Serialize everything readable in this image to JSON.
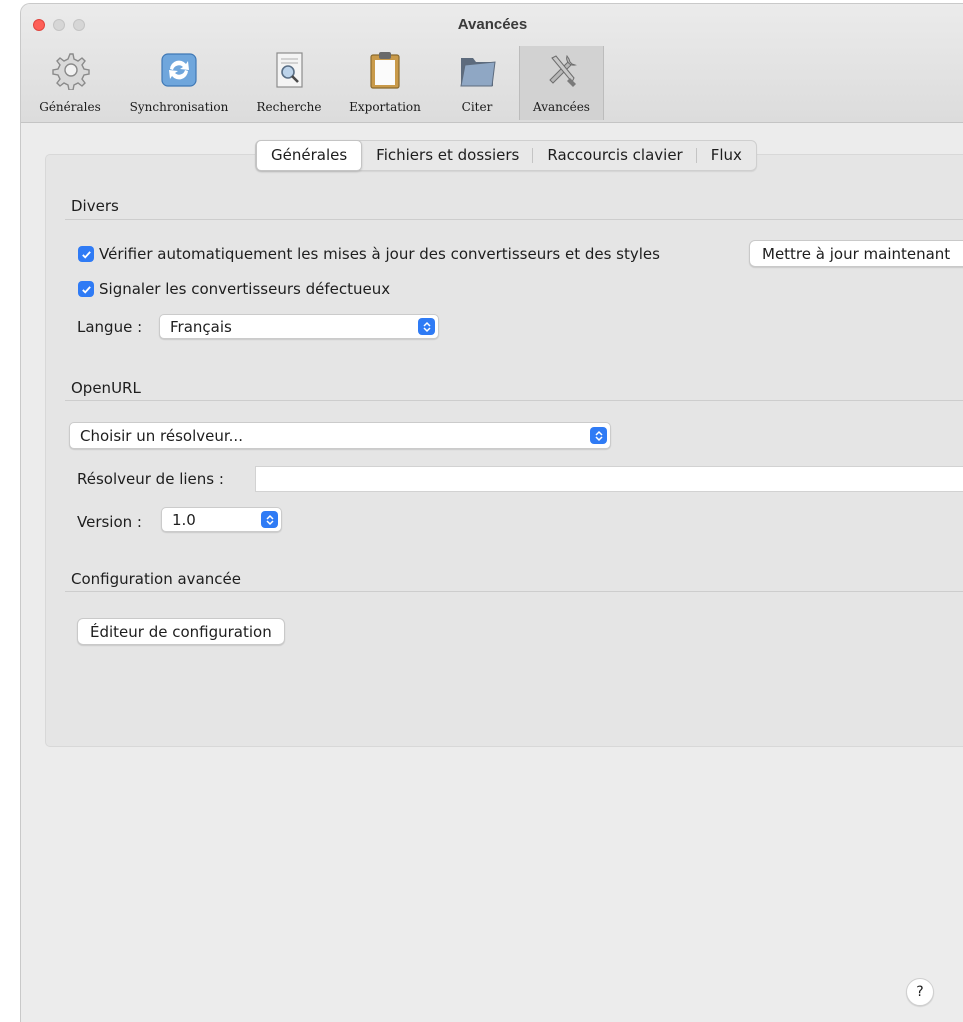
{
  "window": {
    "title": "Avancées",
    "accent_color": "#2f7bf5"
  },
  "toolbar": {
    "items": [
      {
        "label": "Générales",
        "icon": "gear-icon"
      },
      {
        "label": "Synchronisation",
        "icon": "sync-icon"
      },
      {
        "label": "Recherche",
        "icon": "search-document-icon"
      },
      {
        "label": "Exportation",
        "icon": "clipboard-icon"
      },
      {
        "label": "Citer",
        "icon": "folder-icon"
      },
      {
        "label": "Avancées",
        "icon": "tools-icon",
        "active": true
      }
    ]
  },
  "tabs": [
    {
      "label": "Générales",
      "selected": true
    },
    {
      "label": "Fichiers et dossiers"
    },
    {
      "label": "Raccourcis clavier"
    },
    {
      "label": "Flux"
    }
  ],
  "divers": {
    "title": "Divers",
    "auto_update_label": "Vérifier automatiquement les mises à jour des convertisseurs et des styles",
    "auto_update_checked": true,
    "update_now_button": "Mettre à jour maintenant",
    "report_label": "Signaler les convertisseurs défectueux",
    "report_checked": true,
    "language_label": "Langue :",
    "language_value": "Français"
  },
  "openurl": {
    "title": "OpenURL",
    "resolver_select": "Choisir un résolveur...",
    "link_resolver_label": "Résolveur de liens :",
    "link_resolver_value": "",
    "version_label": "Version :",
    "version_value": "1.0"
  },
  "advanced_config": {
    "title": "Configuration avancée",
    "editor_button": "Éditeur de configuration"
  },
  "help_button": "?"
}
